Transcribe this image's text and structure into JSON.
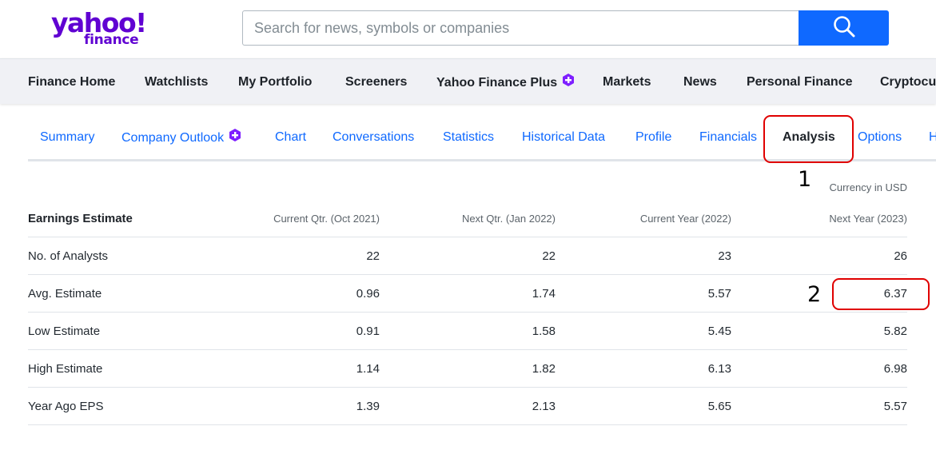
{
  "header": {
    "logo_yahoo": "yahoo!",
    "logo_finance": "finance",
    "search_placeholder": "Search for news, symbols or companies",
    "brand_color": "#6001d2",
    "search_button_color": "#0f69ff",
    "search_icon": "search-icon"
  },
  "nav": {
    "items": [
      {
        "label": "Finance Home"
      },
      {
        "label": "Watchlists"
      },
      {
        "label": "My Portfolio"
      },
      {
        "label": "Screeners"
      },
      {
        "label": "Yahoo Finance Plus",
        "icon": "plus-icon"
      },
      {
        "label": "Markets"
      },
      {
        "label": "News"
      },
      {
        "label": "Personal Finance"
      },
      {
        "label": "Cryptocu"
      }
    ]
  },
  "tabs": {
    "items": [
      {
        "label": "Summary"
      },
      {
        "label": "Company Outlook",
        "icon": "plus-icon"
      },
      {
        "label": "Chart"
      },
      {
        "label": "Conversations"
      },
      {
        "label": "Statistics"
      },
      {
        "label": "Historical Data"
      },
      {
        "label": "Profile"
      },
      {
        "label": "Financials"
      },
      {
        "label": "Analysis",
        "active": true
      },
      {
        "label": "Options"
      },
      {
        "label": "H"
      }
    ]
  },
  "annotations": {
    "marker_1": "1",
    "marker_2": "2",
    "highlight_color": "#e00000"
  },
  "currency_note": "Currency in USD",
  "earnings_table": {
    "headers": [
      "Earnings Estimate",
      "Current Qtr. (Oct 2021)",
      "Next Qtr. (Jan 2022)",
      "Current Year (2022)",
      "Next Year (2023)"
    ],
    "rows": [
      [
        "No. of Analysts",
        "22",
        "22",
        "23",
        "26"
      ],
      [
        "Avg. Estimate",
        "0.96",
        "1.74",
        "5.57",
        "6.37"
      ],
      [
        "Low Estimate",
        "0.91",
        "1.58",
        "5.45",
        "5.82"
      ],
      [
        "High Estimate",
        "1.14",
        "1.82",
        "6.13",
        "6.98"
      ],
      [
        "Year Ago EPS",
        "1.39",
        "2.13",
        "5.65",
        "5.57"
      ]
    ]
  }
}
